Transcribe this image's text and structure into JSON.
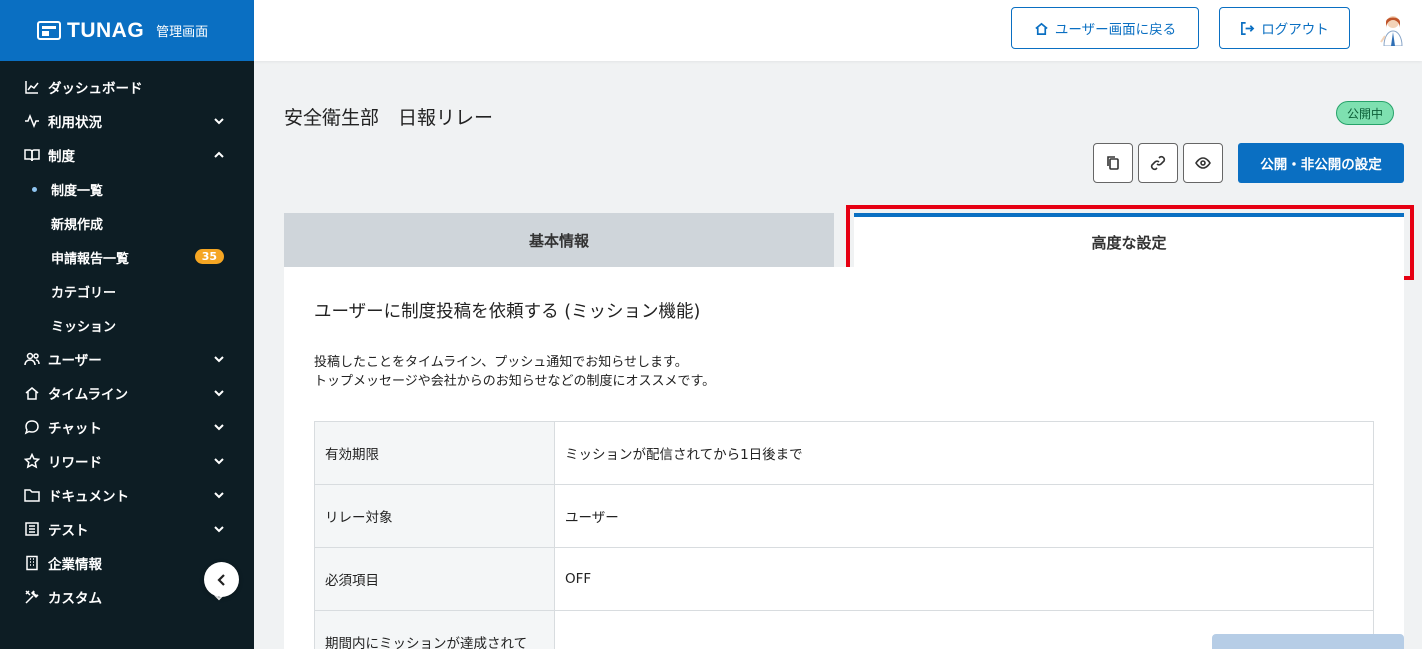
{
  "brand": {
    "name": "TUNAG",
    "subtitle": "管理画面"
  },
  "sidebar": {
    "items": [
      {
        "label": "ダッシュボード",
        "icon": "chart-icon"
      },
      {
        "label": "利用状況",
        "icon": "pulse-icon"
      },
      {
        "label": "制度",
        "icon": "book-icon"
      },
      {
        "label": "ユーザー",
        "icon": "users-icon"
      },
      {
        "label": "タイムライン",
        "icon": "home-icon"
      },
      {
        "label": "チャット",
        "icon": "chat-icon"
      },
      {
        "label": "リワード",
        "icon": "star-icon"
      },
      {
        "label": "ドキュメント",
        "icon": "folder-icon"
      },
      {
        "label": "テスト",
        "icon": "list-icon"
      },
      {
        "label": "企業情報",
        "icon": "building-icon"
      },
      {
        "label": "カスタム",
        "icon": "tools-icon"
      }
    ],
    "sub_items": [
      {
        "label": "制度一覧"
      },
      {
        "label": "新規作成"
      },
      {
        "label": "申請報告一覧",
        "badge": "35"
      },
      {
        "label": "カテゴリー"
      },
      {
        "label": "ミッション"
      }
    ]
  },
  "header": {
    "back_label": "ユーザー画面に戻る",
    "logout_label": "ログアウト"
  },
  "page": {
    "title": "安全衛生部　日報リレー",
    "status": "公開中",
    "publish_label": "公開・非公開の設定"
  },
  "tabs": {
    "basic": "基本情報",
    "advanced": "高度な設定"
  },
  "section": {
    "title": "ユーザーに制度投稿を依頼する (ミッション機能)",
    "desc_line1": "投稿したことをタイムライン、プッシュ通知でお知らせします。",
    "desc_line2": "トップメッセージや会社からのお知らせなどの制度にオススメです。"
  },
  "settings_table": {
    "rows": [
      {
        "label": "有効期限",
        "value": "ミッションが配信されてから1日後まで"
      },
      {
        "label": "リレー対象",
        "value": "ユーザー"
      },
      {
        "label": "必須項目",
        "value": "OFF"
      },
      {
        "label": "期間内にミッションが達成されて",
        "value": ""
      }
    ]
  },
  "colors": {
    "brand_blue": "#0a6fc2",
    "sidebar_bg": "#0d1d24",
    "highlight_red": "#e60012"
  }
}
